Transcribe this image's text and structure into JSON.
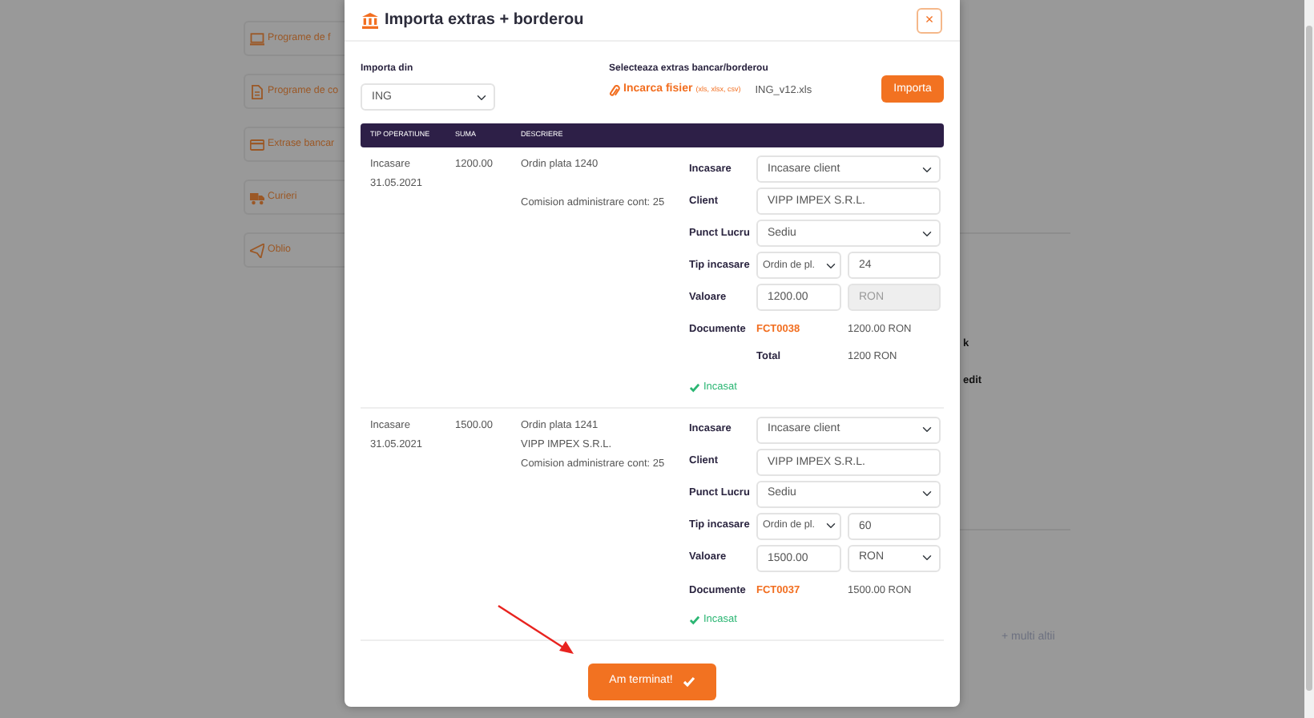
{
  "background": {
    "menu": [
      {
        "label": "Programe de f"
      },
      {
        "label": "Programe de co"
      },
      {
        "label": "Extrase bancar"
      },
      {
        "label": "Curieri"
      },
      {
        "label": "Oblio"
      }
    ],
    "fragments": [
      "k",
      "edit"
    ],
    "partners_more": "+ multi altii"
  },
  "modal": {
    "title": "Importa extras + borderou",
    "close": "×",
    "source": {
      "label": "Importa din",
      "value": "ING"
    },
    "file": {
      "label": "Selecteaza extras bancar/borderou",
      "upload": "Incarca fisier",
      "formats": "(xls, xlsx, csv)",
      "filename": "ING_v12.xls",
      "button": "Importa"
    },
    "columns": [
      "TIP OPERATIUNE",
      "SUMA",
      "DESCRIERE"
    ],
    "rows": [
      {
        "type": "Incasare",
        "date": "31.05.2021",
        "amount": "1200.00",
        "description": [
          {
            "text": "Ordin plata 1240",
            "blank_after": true
          },
          {
            "text": "Comision administrare cont: 25",
            "blank_after": false
          }
        ],
        "form": {
          "operation_label": "Incasare",
          "operation": "Incasare client",
          "client_label": "Client",
          "client": "VIPP IMPEX S.R.L.",
          "location_label": "Punct Lucru",
          "location": "Sediu",
          "payment_label": "Tip incasare",
          "payment_type": "Ordin de pl.",
          "payment_number": "24",
          "value_label": "Valoare",
          "value": "1200.00",
          "currency": "RON",
          "currency_disabled": true,
          "documents_label": "Documente",
          "documents": [
            {
              "code": "FCT0038",
              "amount": "1200.00 RON"
            }
          ],
          "total_label": "Total",
          "total": "1200 RON",
          "status": "Incasat"
        }
      },
      {
        "type": "Incasare",
        "date": "31.05.2021",
        "amount": "1500.00",
        "description": [
          {
            "text": "Ordin plata 1241",
            "blank_after": false
          },
          {
            "text": "VIPP IMPEX S.R.L.",
            "blank_after": false
          },
          {
            "text": "Comision administrare cont: 25",
            "blank_after": false
          }
        ],
        "form": {
          "operation_label": "Incasare",
          "operation": "Incasare client",
          "client_label": "Client",
          "client": "VIPP IMPEX S.R.L.",
          "location_label": "Punct Lucru",
          "location": "Sediu",
          "payment_label": "Tip incasare",
          "payment_type": "Ordin de pl.",
          "payment_number": "60",
          "value_label": "Valoare",
          "value": "1500.00",
          "currency": "RON",
          "currency_disabled": false,
          "documents_label": "Documente",
          "documents": [
            {
              "code": "FCT0037",
              "amount": "1500.00 RON"
            }
          ],
          "status": "Incasat"
        }
      }
    ],
    "finish_button": "Am terminat!"
  }
}
